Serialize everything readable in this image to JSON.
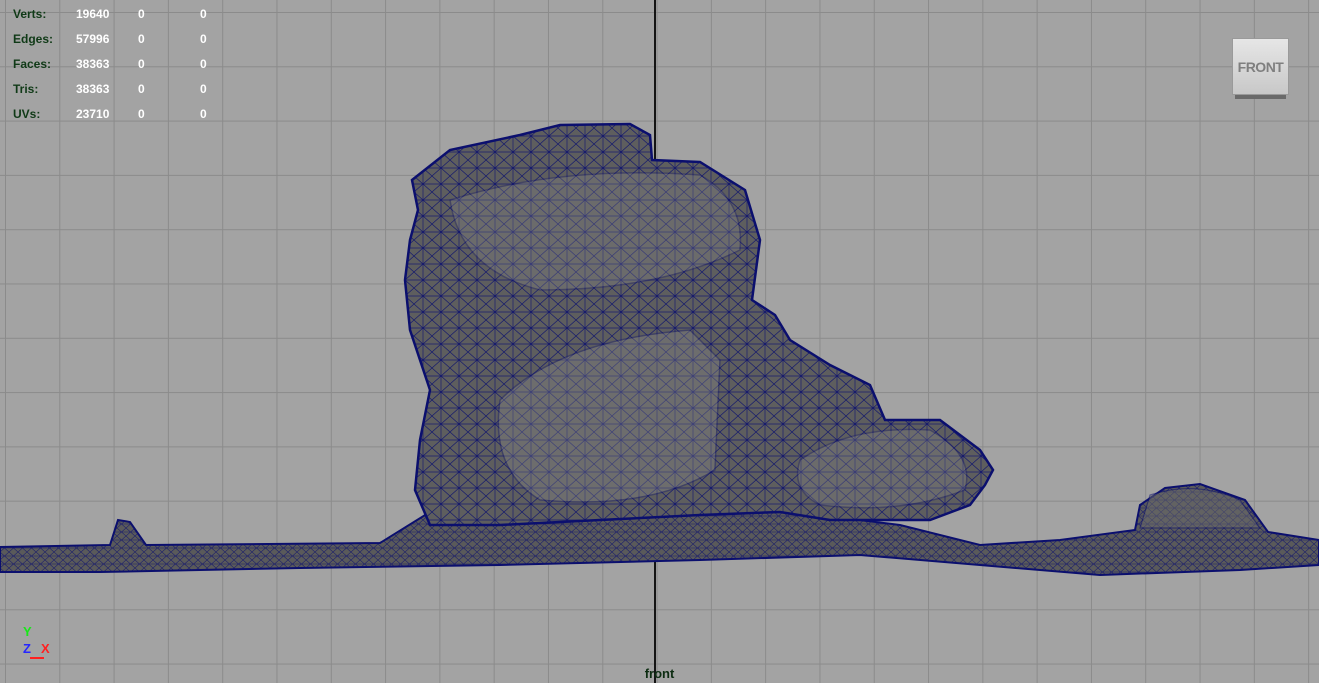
{
  "hud": {
    "rows": [
      {
        "label": "Verts:",
        "v1": "19640",
        "v2": "0",
        "v3": "0"
      },
      {
        "label": "Edges:",
        "v1": "57996",
        "v2": "0",
        "v3": "0"
      },
      {
        "label": "Faces:",
        "v1": "38363",
        "v2": "0",
        "v3": "0"
      },
      {
        "label": "Tris:",
        "v1": "38363",
        "v2": "0",
        "v3": "0"
      },
      {
        "label": "UVs:",
        "v1": "23710",
        "v2": "0",
        "v3": "0"
      }
    ]
  },
  "view_cube": {
    "label": "FRONT"
  },
  "camera": {
    "name": "front"
  },
  "axis_gizmo": {
    "y": "Y",
    "z": "Z",
    "x": "X"
  },
  "colors": {
    "viewport_bg": "#a3a3a3",
    "grid_line": "#8b8b8b",
    "wireframe": "#0b0f6e",
    "mesh_fill": "#5c5c5c",
    "hud_label": "#103a17",
    "hud_value": "#ffffff"
  }
}
